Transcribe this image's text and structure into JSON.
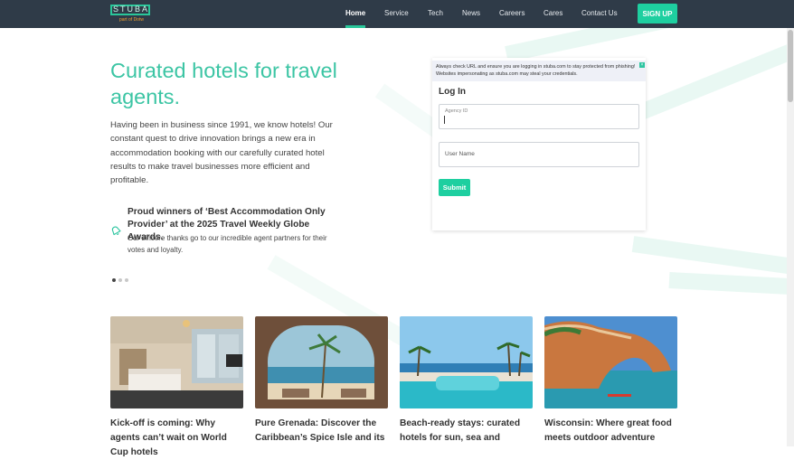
{
  "header": {
    "logo_text": "STUBA",
    "logo_tagline": "part of Dotw",
    "nav": [
      {
        "label": "Home",
        "active": true
      },
      {
        "label": "Service",
        "active": false
      },
      {
        "label": "Tech",
        "active": false
      },
      {
        "label": "News",
        "active": false
      },
      {
        "label": "Careers",
        "active": false
      },
      {
        "label": "Cares",
        "active": false
      },
      {
        "label": "Contact Us",
        "active": false
      }
    ],
    "signup_label": "SIGN UP"
  },
  "hero": {
    "title": "Curated hotels for travel agents.",
    "body": "Having been in business since 1991, we know hotels! Our constant quest to drive innovation brings a new era in accommodation booking with our carefully curated hotel results to make travel businesses more efficient and profitable.",
    "award_title": "Proud winners of ‘Best Accommodation Only Provider’ at the 2025 Travel Weekly Globe Awards.",
    "award_body": "Our sincere thanks go to our incredible agent partners for their votes and loyalty.",
    "award_icon": "bell-icon",
    "slides": 3,
    "active_slide": 1
  },
  "login": {
    "notice": "Always check URL and ensure you are logging in stuba.com to stay protected from phishing! Websites impersonating as stuba.com may steal your credentials.",
    "close_symbol": "×",
    "title": "Log In",
    "agency_label": "Agency ID",
    "agency_value": "",
    "username_placeholder": "User Name",
    "submit_label": "Submit"
  },
  "articles": [
    {
      "title": "Kick-off is coming: Why agents can’t wait on World Cup hotels",
      "image": "hotel-room-photo"
    },
    {
      "title": "Pure Grenada: Discover the Caribbean’s Spice Isle and its",
      "image": "beach-balcony-photo"
    },
    {
      "title": "Beach-ready stays: curated hotels for sun, sea and",
      "image": "resort-pool-photo"
    },
    {
      "title": "Wisconsin: Where great food meets outdoor adventure",
      "image": "sea-arch-kayak-photo"
    }
  ],
  "colors": {
    "accent": "#1ecfa0",
    "header_bg": "#2f3b48",
    "title_green": "#3cc5a4"
  }
}
